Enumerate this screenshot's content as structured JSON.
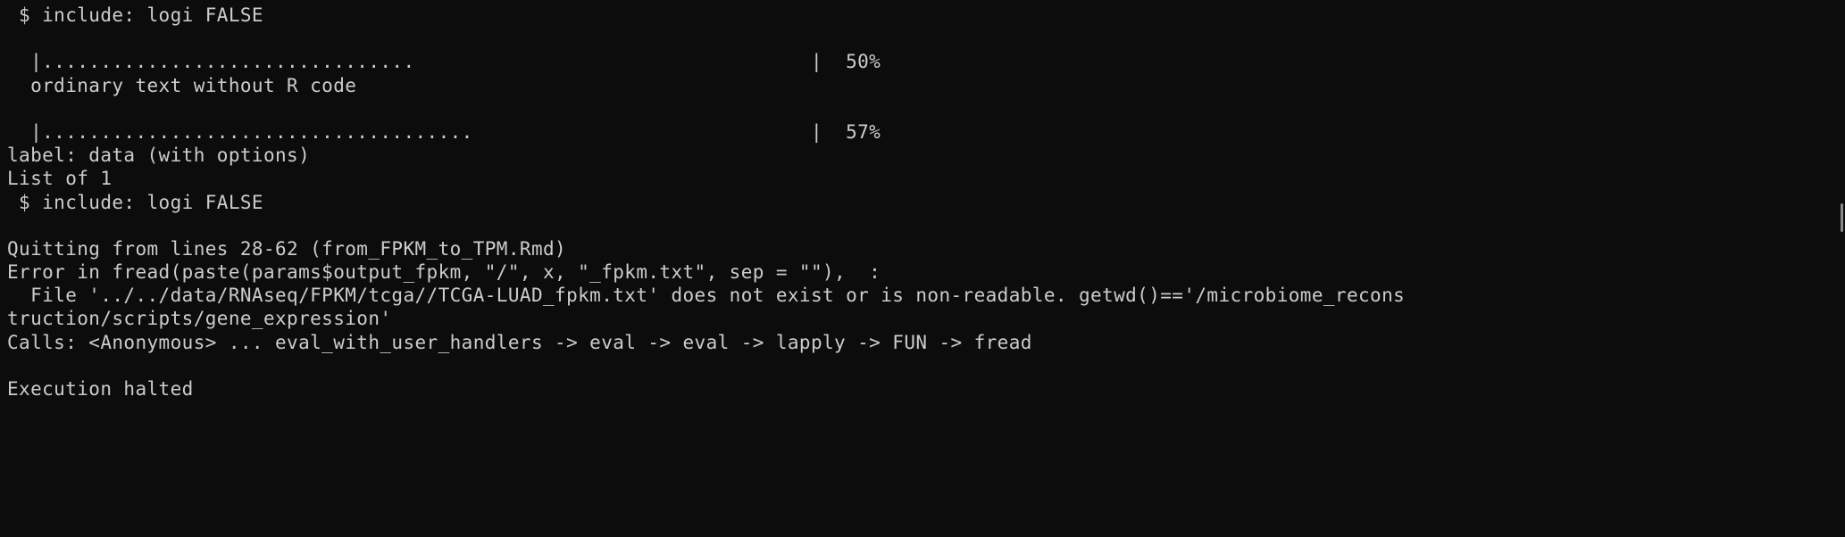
{
  "terminal": {
    "lines": [
      " $ include: logi FALSE",
      "",
      "  |................................                                  |  50%",
      "  ordinary text without R code",
      "",
      "  |.....................................                             |  57%",
      "label: data (with options)",
      "List of 1",
      " $ include: logi FALSE",
      "",
      "Quitting from lines 28-62 (from_FPKM_to_TPM.Rmd)",
      "Error in fread(paste(params$output_fpkm, \"/\", x, \"_fpkm.txt\", sep = \"\"),  :",
      "  File '../../data/RNAseq/FPKM/tcga//TCGA-LUAD_fpkm.txt' does not exist or is non-readable. getwd()=='/microbiome_recons",
      "truction/scripts/gene_expression'",
      "Calls: <Anonymous> ... eval_with_user_handlers -> eval -> eval -> lapply -> FUN -> fread",
      "",
      "Execution halted"
    ]
  },
  "colors": {
    "background": "#0c0c0c",
    "foreground": "#cccccc",
    "scrollbar_thumb": "#8a8a8a"
  }
}
